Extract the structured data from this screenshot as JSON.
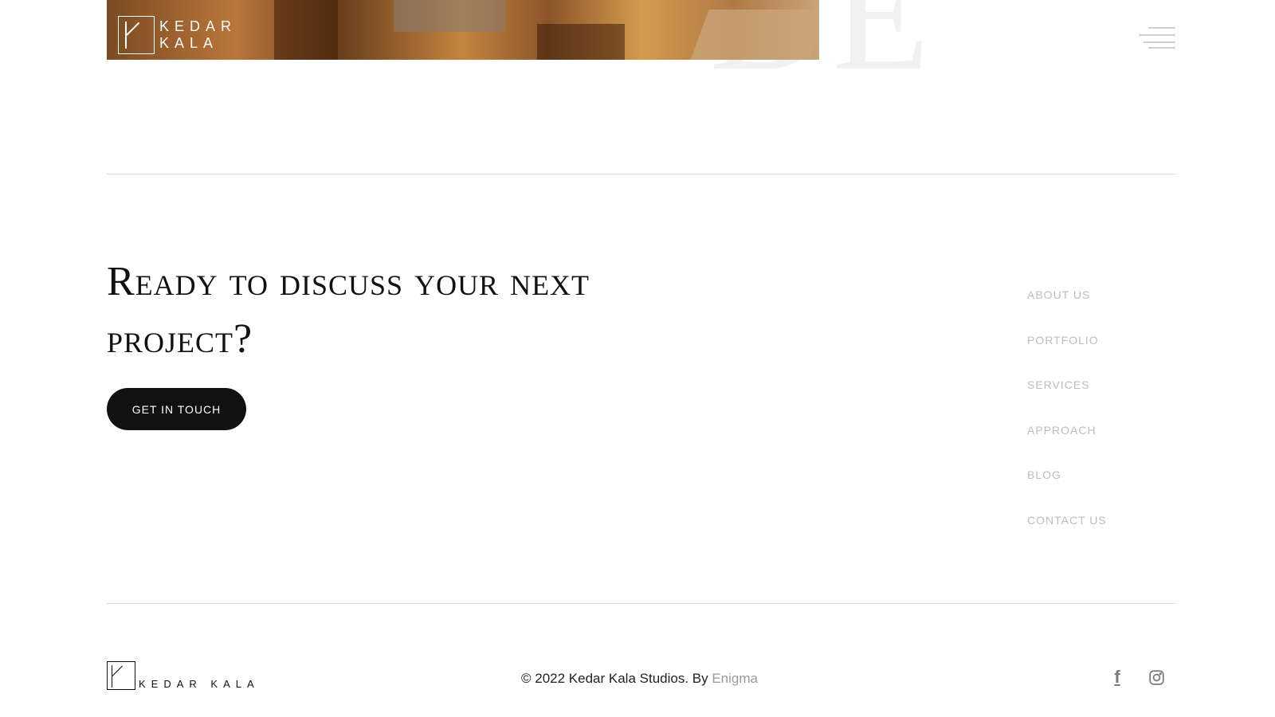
{
  "brand": {
    "line1": "KEDAR",
    "line2": "KALA",
    "footer_name": "KEDAR KALA"
  },
  "cta": {
    "title": "Ready to discuss your next project?",
    "button": "GET IN TOUCH"
  },
  "footer_nav": [
    "ABOUT US",
    "PORTFOLIO",
    "SERVICES",
    "APPROACH",
    "BLOG",
    "CONTACT US"
  ],
  "copyright": {
    "text": "© 2022 Kedar Kala Studios. By ",
    "link": "Enigma"
  },
  "social": {
    "facebook_glyph": "f",
    "facebook_icon": "facebook-icon",
    "instagram_icon": "instagram-icon"
  },
  "colors": {
    "button_bg": "#111111",
    "nav_text": "#bdbdbd",
    "rule": "#dadada"
  }
}
